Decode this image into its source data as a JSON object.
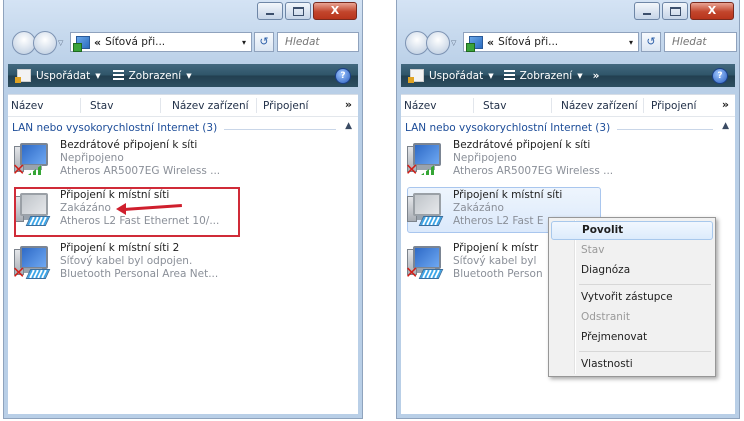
{
  "window_controls": {
    "close_glyph": "X"
  },
  "address": {
    "chevron": "«",
    "path": "Síťová při...",
    "dropdown_glyph": "▾",
    "refresh_glyph": "↺"
  },
  "search": {
    "placeholder": "Hledat"
  },
  "toolbar": {
    "organize_label": "Uspořádat",
    "views_label": "Zobrazení",
    "more_glyph": "»",
    "help_glyph": "?"
  },
  "columns": [
    "Název",
    "Stav",
    "Název zařízení",
    "Připojení"
  ],
  "columns_more_glyph": "»",
  "group": {
    "label": "LAN nebo vysokorychlostní Internet (3)"
  },
  "left_panel": {
    "items": [
      {
        "name": "Bezdrátové připojení k síti",
        "status": "Nepřipojeno",
        "device": "Atheros AR5007EG Wireless ..."
      },
      {
        "name": "Připojení k místní síti",
        "status": "Zakázáno",
        "device": "Atheros L2 Fast Ethernet 10/..."
      },
      {
        "name": "Připojení k místní síti 2",
        "status": "Síťový kabel byl odpojen.",
        "device": "Bluetooth Personal Area Net..."
      }
    ]
  },
  "right_panel": {
    "items": [
      {
        "name": "Bezdrátové připojení k síti",
        "status": "Nepřipojeno",
        "device": "Atheros AR5007EG Wireless ..."
      },
      {
        "name": "Připojení k místní síti",
        "status": "Zakázáno",
        "device": "Atheros L2 Fast E"
      },
      {
        "name": "Připojení k místr",
        "status": "Síťový kabel byl",
        "device": "Bluetooth Person"
      }
    ]
  },
  "context_menu": {
    "items": [
      {
        "label": "Povolit",
        "bold": true
      },
      {
        "label": "Stav",
        "disabled": true
      },
      {
        "label": "Diagnóza"
      },
      {
        "label": "Vytvořit zástupce"
      },
      {
        "label": "Odstranit",
        "disabled": true
      },
      {
        "label": "Přejmenovat"
      },
      {
        "label": "Vlastnosti"
      }
    ]
  },
  "colors": {
    "toolbar": "#2e5468",
    "highlight_box": "#d02b38",
    "group_text": "#1c4c98",
    "close_button": "#c2452c"
  }
}
